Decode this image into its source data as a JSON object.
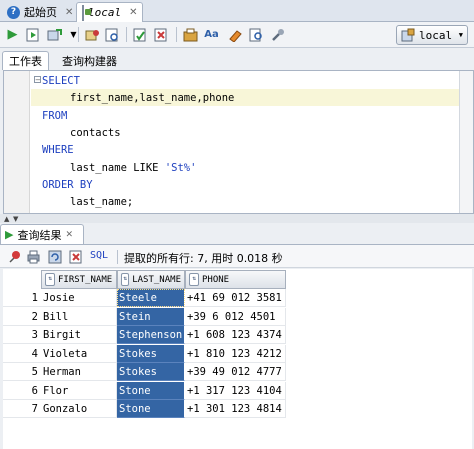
{
  "doc_tabs": [
    {
      "label": "起始页",
      "icon": "start-page-icon",
      "active": false
    },
    {
      "label": "local",
      "icon": "sql-worksheet-icon",
      "active": true
    }
  ],
  "toolbar": {
    "icons": [
      "run-statement-icon",
      "run-script-icon",
      "commit-icon",
      "rollback-icon",
      "autotrace-icon",
      "explain-plan-icon",
      "sql-tuning-icon",
      "clear-icon",
      "sql-history-icon",
      "unshared-worksheet-icon",
      "to-upper-icon",
      "format-icon",
      "erase-icon",
      "find-icon",
      "tools-icon"
    ],
    "connection": "local"
  },
  "sub_tabs": [
    "工作表",
    "查询构建器"
  ],
  "sql_lines": [
    {
      "kw": "SELECT",
      "text": ""
    },
    {
      "kw": "",
      "text": "first_name,last_name,phone"
    },
    {
      "kw": "FROM",
      "text": ""
    },
    {
      "kw": "",
      "text": "contacts"
    },
    {
      "kw": "WHERE",
      "text": ""
    },
    {
      "kw": "",
      "text": "last_name LIKE ",
      "str": "'St%'"
    },
    {
      "kw": "ORDER BY",
      "text": ""
    },
    {
      "kw": "",
      "text": "last_name;"
    }
  ],
  "results": {
    "tab_label": "查询结果",
    "status": "提取的所有行: 7, 用时 0.018 秒",
    "sql_label": "SQL",
    "columns": [
      "FIRST_NAME",
      "LAST_NAME",
      "PHONE"
    ],
    "rows": [
      {
        "n": "1",
        "first": "Josie",
        "last": "Steele",
        "phone": "+41 69 012 3581"
      },
      {
        "n": "2",
        "first": "Bill",
        "last": "Stein",
        "phone": "+39 6 012 4501"
      },
      {
        "n": "3",
        "first": "Birgit",
        "last": "Stephenson",
        "phone": "+1 608 123 4374"
      },
      {
        "n": "4",
        "first": "Violeta",
        "last": "Stokes",
        "phone": "+1 810 123 4212"
      },
      {
        "n": "5",
        "first": "Herman",
        "last": "Stokes",
        "phone": "+39 49 012 4777"
      },
      {
        "n": "6",
        "first": "Flor",
        "last": "Stone",
        "phone": "+1 317 123 4104"
      },
      {
        "n": "7",
        "first": "Gonzalo",
        "last": "Stone",
        "phone": "+1 301 123 4814"
      }
    ]
  }
}
